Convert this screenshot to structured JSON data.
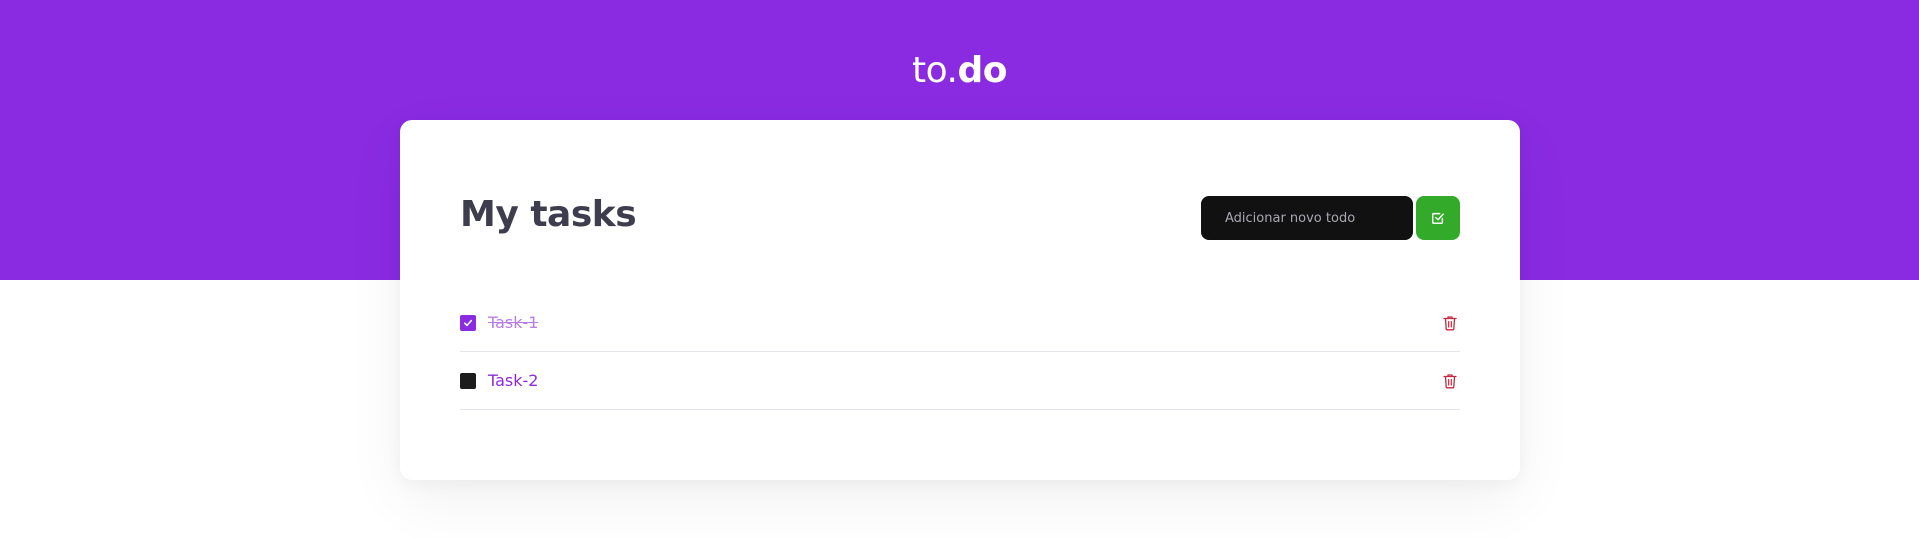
{
  "header": {
    "logo_light": "to.",
    "logo_bold": "do"
  },
  "main": {
    "title": "My tasks",
    "new_todo": {
      "placeholder": "Adicionar novo todo",
      "value": ""
    },
    "add_button": {
      "icon": "check-square-icon"
    },
    "tasks": [
      {
        "title": "Task-1",
        "done": true,
        "delete_icon": "trash-icon"
      },
      {
        "title": "Task-2",
        "done": false,
        "delete_icon": "trash-icon"
      }
    ]
  },
  "colors": {
    "header": "#8A2BE2",
    "accent": "#8A2BE2",
    "add_button": "#33AA2A",
    "delete_icon": "#C5283D",
    "title": "#3D3D4D",
    "input_bg": "#111111"
  }
}
